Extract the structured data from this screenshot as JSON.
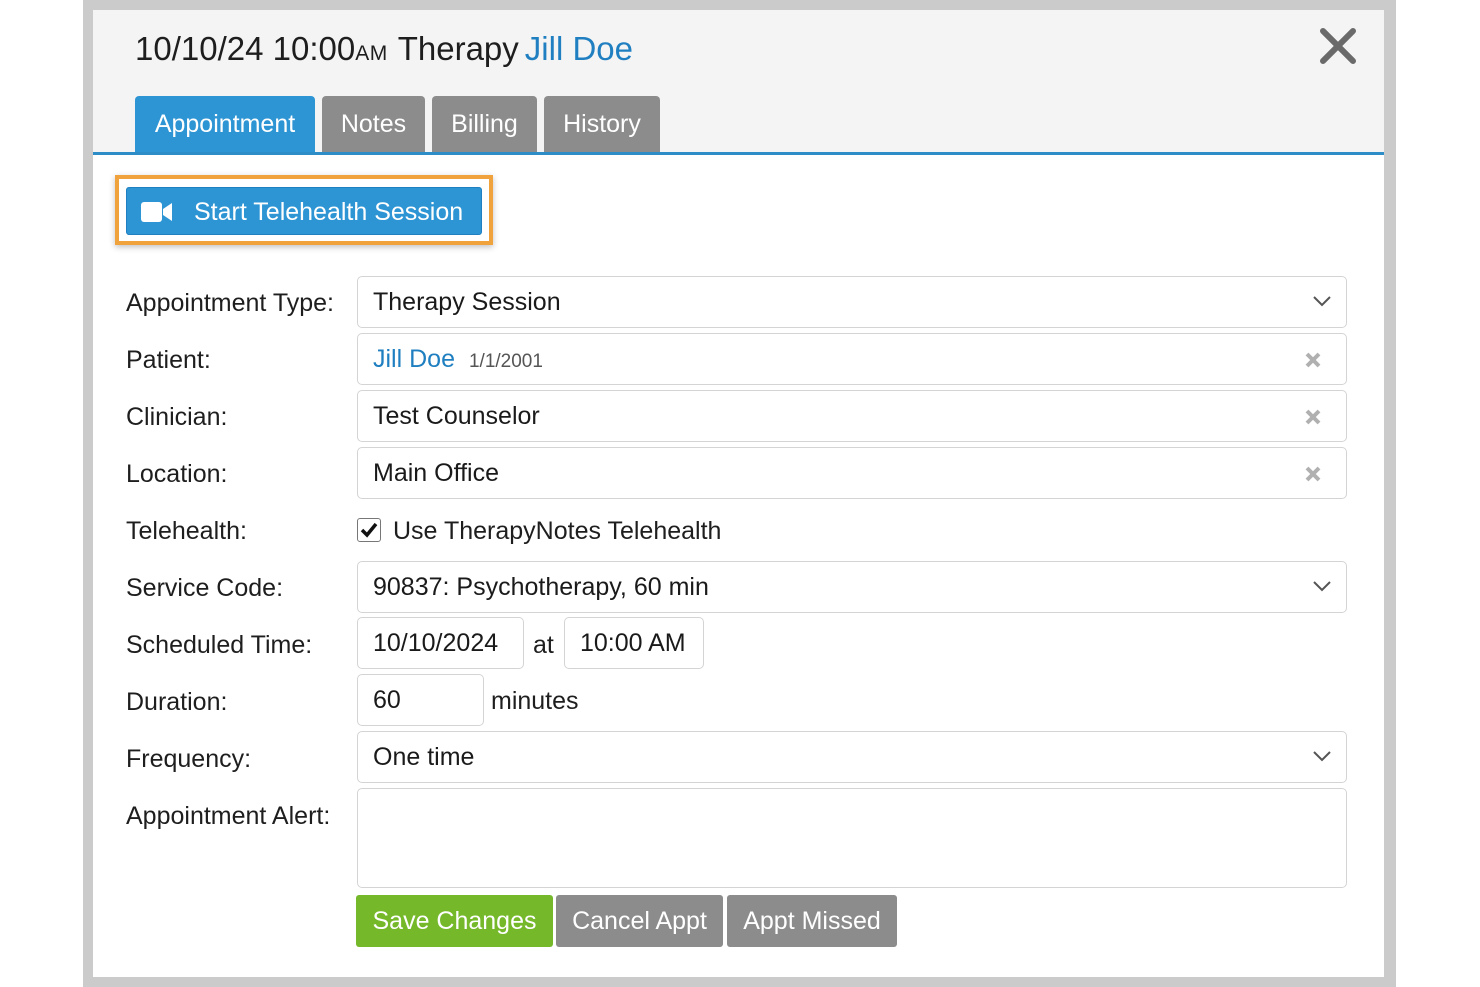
{
  "header": {
    "date_time": "10/10/24 10:00",
    "ampm": "AM",
    "appt_type": "Therapy",
    "patient_name": "Jill Doe"
  },
  "tabs": [
    {
      "label": "Appointment",
      "active": true
    },
    {
      "label": "Notes",
      "active": false
    },
    {
      "label": "Billing",
      "active": false
    },
    {
      "label": "History",
      "active": false
    }
  ],
  "telehealth_button": {
    "label": "Start Telehealth Session",
    "icon": "video-camera-icon"
  },
  "form": {
    "appointment_type": {
      "label": "Appointment Type:",
      "value": "Therapy Session"
    },
    "patient": {
      "label": "Patient:",
      "name": "Jill Doe",
      "dob": "1/1/2001"
    },
    "clinician": {
      "label": "Clinician:",
      "value": "Test Counselor"
    },
    "location": {
      "label": "Location:",
      "value": "Main Office"
    },
    "telehealth": {
      "label": "Telehealth:",
      "checkbox_label": "Use TherapyNotes Telehealth",
      "checked": true
    },
    "service_code": {
      "label": "Service Code:",
      "value": "90837: Psychotherapy, 60 min"
    },
    "scheduled_time": {
      "label": "Scheduled Time:",
      "date": "10/10/2024",
      "at": "at",
      "time": "10:00 AM"
    },
    "duration": {
      "label": "Duration:",
      "value": "60",
      "unit": "minutes"
    },
    "frequency": {
      "label": "Frequency:",
      "value": "One time"
    },
    "appointment_alert": {
      "label": "Appointment Alert:",
      "value": ""
    }
  },
  "actions": {
    "save": "Save Changes",
    "cancel": "Cancel Appt",
    "missed": "Appt Missed"
  },
  "colors": {
    "accent": "#2d95d4",
    "link": "#1f7fc0",
    "save": "#75b82a",
    "secondary": "#8c8c8c",
    "highlight": "#f0a33c"
  }
}
